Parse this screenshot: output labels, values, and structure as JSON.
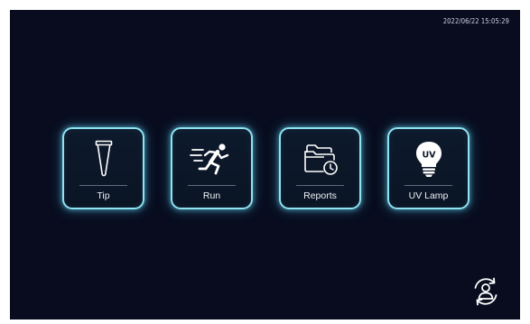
{
  "status_bar": {
    "datetime": "2022/06/22 15:05:29"
  },
  "menu": {
    "tiles": [
      {
        "label": "Tip",
        "icon": "tip-icon"
      },
      {
        "label": "Run",
        "icon": "running-person-icon"
      },
      {
        "label": "Reports",
        "icon": "folder-clock-icon"
      },
      {
        "label": "UV Lamp",
        "icon": "uv-bulb-icon",
        "icon_text": "UV"
      }
    ]
  },
  "footer": {
    "icon": "switch-user-icon"
  },
  "colors": {
    "background": "#080c1e",
    "tile_border": "#8fe3f2",
    "icon_white": "#ffffff",
    "text": "#eef3f8"
  }
}
